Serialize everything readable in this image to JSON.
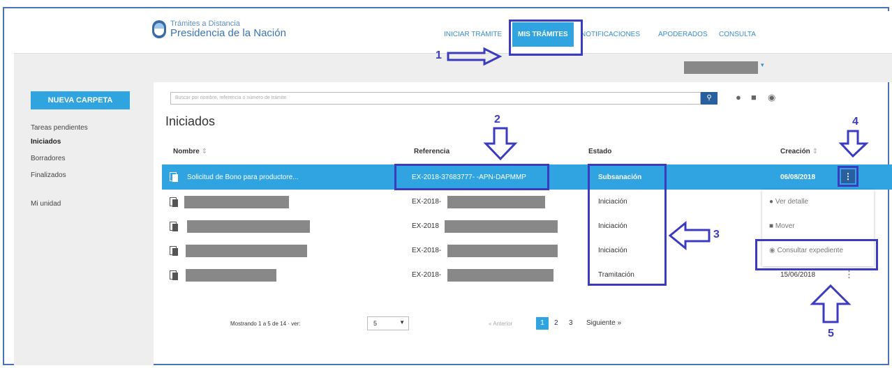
{
  "header": {
    "logo_line1": "Trámites a Distancia",
    "logo_line2": "Presidencia de la Nación",
    "nav": [
      "INICIAR TRÁMITE",
      "MIS TRÁMITES",
      "NOTIFICACIONES",
      "APODERADOS",
      "CONSULTA"
    ],
    "active_nav": "MIS TRÁMITES"
  },
  "sidebar": {
    "new_folder": "NUEVA CARPETA",
    "items": [
      "Tareas pendientes",
      "Iniciados",
      "Borradores",
      "Finalizados",
      "Mi unidad"
    ],
    "active_item": "Iniciados"
  },
  "search": {
    "placeholder": "Buscar por nombre, referencia o número de trámite"
  },
  "main": {
    "title": "Iniciados"
  },
  "table": {
    "headers": {
      "nombre": "Nombre",
      "referencia": "Referencia",
      "estado": "Estado",
      "creacion": "Creación"
    },
    "rows": [
      {
        "nombre": "Solicitud de Bono para productore...",
        "referencia": "EX-2018-37683777- -APN-DAPMMP",
        "estado": "Subsanación",
        "creacion": "06/08/2018",
        "selected": true
      },
      {
        "nombre": "",
        "referencia": "EX-2018-",
        "estado": "Iniciación",
        "creacion": ""
      },
      {
        "nombre": "",
        "referencia": "EX-2018",
        "estado": "Iniciación",
        "creacion": ""
      },
      {
        "nombre": "",
        "referencia": "EX-2018-",
        "estado": "Iniciación",
        "creacion": ""
      },
      {
        "nombre": "",
        "referencia": "EX-2018-",
        "estado": "Tramitación",
        "creacion": "15/06/2018"
      }
    ]
  },
  "row_menu": {
    "items": [
      "Ver detalle",
      "Mover",
      "Consultar expediente"
    ]
  },
  "footer": {
    "showing": "Mostrando 1 a 5 de 14 · ver:",
    "per_page": "5",
    "prev": "« Anterior",
    "pages": [
      "1",
      "2",
      "3"
    ],
    "active_page": "1",
    "next": "Siguiente »"
  },
  "annotations": [
    "1",
    "2",
    "3",
    "4",
    "5"
  ],
  "colors": {
    "accent": "#2fa4e0",
    "dark_accent": "#2a5f9e",
    "annotation": "#3b3bbf"
  }
}
